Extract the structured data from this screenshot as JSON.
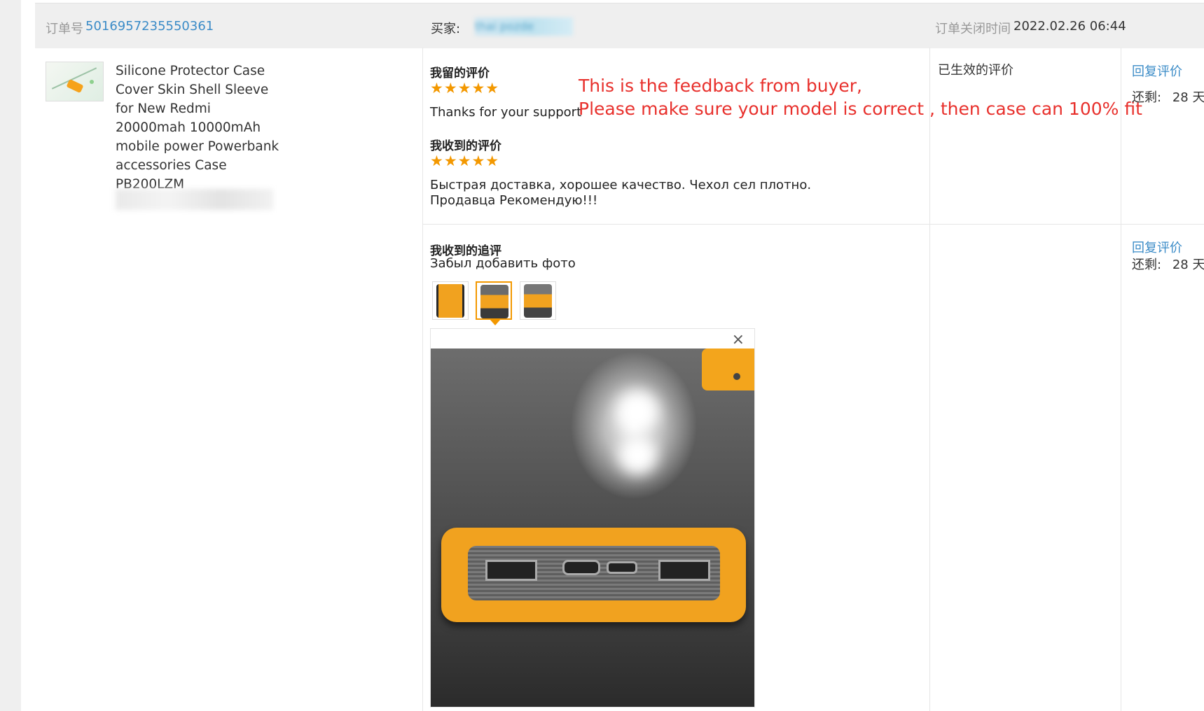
{
  "header": {
    "order_label": "订单号",
    "order_number": "5016957235550361",
    "buyer_label": "买家:",
    "buyer_name": "thai pozde",
    "closed_time_label": "订单关闭时间",
    "closed_time_value": "2022.02.26 06:44"
  },
  "product": {
    "title": "Silicone Protector Case Cover Skin Shell Sleeve for New Redmi 20000mah 10000mAh mobile power Powerbank accessories Case PB200LZM"
  },
  "reviews": {
    "my_review_title": "我留的评价",
    "my_review_stars": "★★★★★",
    "my_review_text": "Thanks for your support",
    "received_title": "我收到的评价",
    "received_stars": "★★★★★",
    "received_text": "Быстрая доставка, хорошее качество. Чехол сел плотно. Продавца Рекомендую!!!",
    "followup_title": "我收到的追评",
    "followup_text": "Забыл добавить фото",
    "photo_count": 3,
    "selected_photo": 2
  },
  "annotation": {
    "line1": "This is the feedback from buyer,",
    "line2": "Please make sure your model is correct , then case can 100% fit"
  },
  "status": {
    "effective_label": "已生效的评价"
  },
  "actions": {
    "reply_label": "回复评价",
    "remaining_label": "还剩:",
    "remaining_value": "28 天"
  },
  "preview": {
    "close_glyph": "×"
  },
  "colors": {
    "link": "#3a8bc7",
    "star": "#f39800",
    "annotation": "#e8302c"
  }
}
